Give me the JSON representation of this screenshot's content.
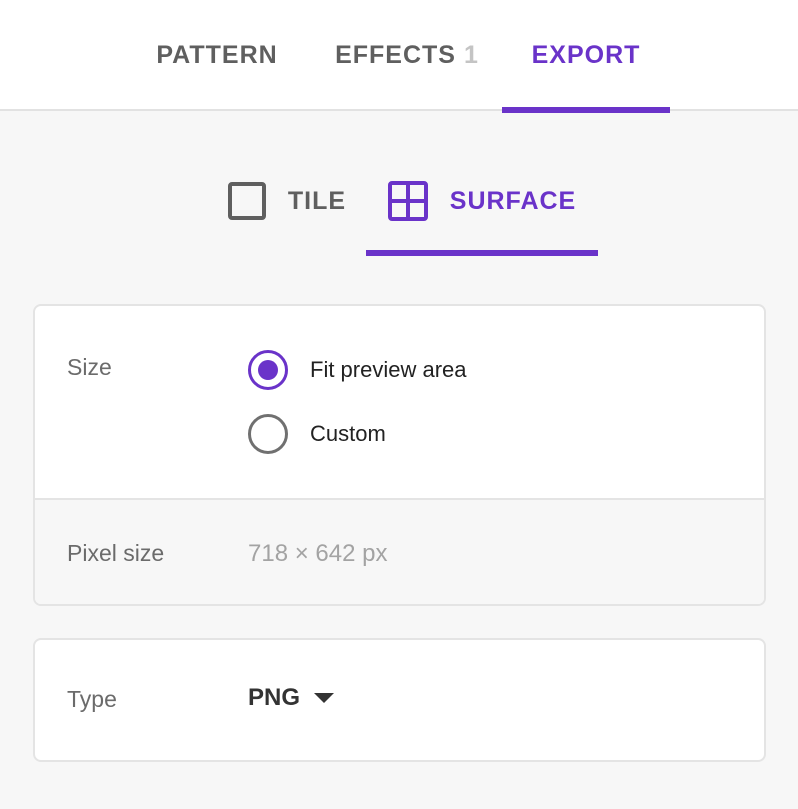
{
  "tabs": {
    "pattern": "PATTERN",
    "effects": "EFFECTS",
    "effects_count": "1",
    "export": "EXPORT"
  },
  "subtabs": {
    "tile": "TILE",
    "surface": "SURFACE"
  },
  "size_card": {
    "label": "Size",
    "options": [
      "Fit preview area",
      "Custom"
    ],
    "selected": "Fit preview area",
    "pixel_label": "Pixel size",
    "pixel_value": "718 × 642 px"
  },
  "type_card": {
    "label": "Type",
    "value": "PNG"
  },
  "colors": {
    "accent": "#6a33c9",
    "text": "#5f5f5f",
    "background": "#f7f7f7"
  },
  "icons": {
    "tile": "square-outline-icon",
    "surface": "grid-icon",
    "dropdown": "caret-down-icon"
  }
}
